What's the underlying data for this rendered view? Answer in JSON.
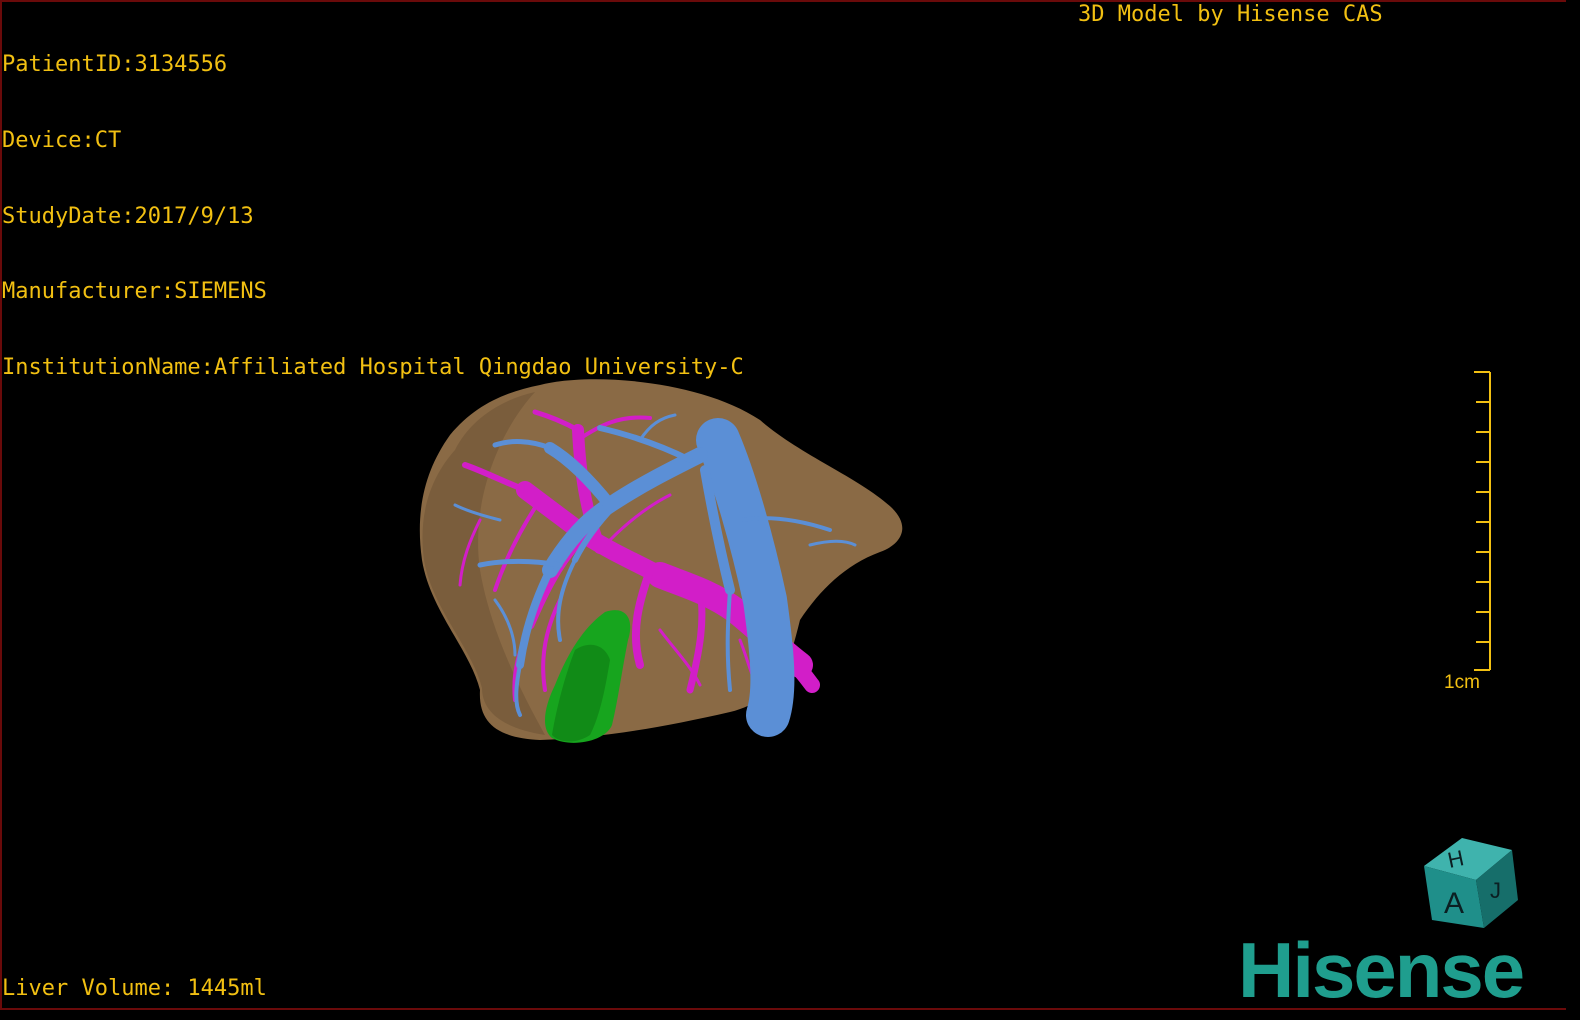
{
  "overlay": {
    "patient_id": "PatientID:3134556",
    "device": "Device:CT",
    "study_date": "StudyDate:2017/9/13",
    "manufacturer": "Manufacturer:SIEMENS",
    "institution": "InstitutionName:Affiliated Hospital Qingdao University-C",
    "credit": "3D Model by Hisense CAS",
    "liver_volume": "Liver Volume: 1445ml"
  },
  "scale_bar": {
    "label": "1cm"
  },
  "orientation_cube": {
    "face_front": "A",
    "face_top": "H",
    "face_side": "J"
  },
  "brand": {
    "logo_text": "Hisense"
  },
  "colors": {
    "overlay_text": "#f2c012",
    "liver": "#8a6a45",
    "hepatic_vein": "#5b8fd6",
    "portal_vein": "#d21ec8",
    "gallbladder": "#17a51e",
    "brand": "#1f9e8e",
    "cube": "#1f8f8a"
  }
}
